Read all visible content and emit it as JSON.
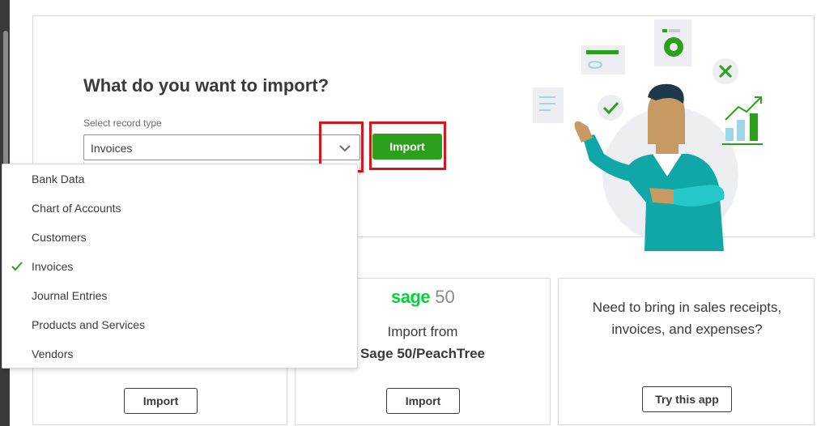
{
  "hero": {
    "title": "What do you want to import?",
    "field_label": "Select record type",
    "selected_value": "Invoices",
    "import_label": "Import"
  },
  "dropdown": {
    "selected": "Invoices",
    "options": [
      {
        "label": "Bank Data"
      },
      {
        "label": "Chart of Accounts"
      },
      {
        "label": "Customers"
      },
      {
        "label": "Invoices",
        "checked": true
      },
      {
        "label": "Journal Entries"
      },
      {
        "label": "Products and Services"
      },
      {
        "label": "Vendors"
      }
    ]
  },
  "cards": {
    "card1": {
      "button_label": "Import"
    },
    "card2": {
      "logo_word": "sage",
      "logo_number": "50",
      "line1": "Import from",
      "line2": "Sage 50/PeachTree",
      "button_label": "Import"
    },
    "card3": {
      "text": "Need to bring in sales receipts, invoices, and expenses?",
      "button_label": "Try this app"
    }
  },
  "colors": {
    "primary_green": "#2ca01c",
    "highlight_red": "#d9151c",
    "sage_green": "#00d639",
    "text": "#393a3d"
  },
  "icons": {
    "chevron": "chevron-down-icon",
    "check": "check-icon",
    "illustration": "import-person-illustration"
  }
}
